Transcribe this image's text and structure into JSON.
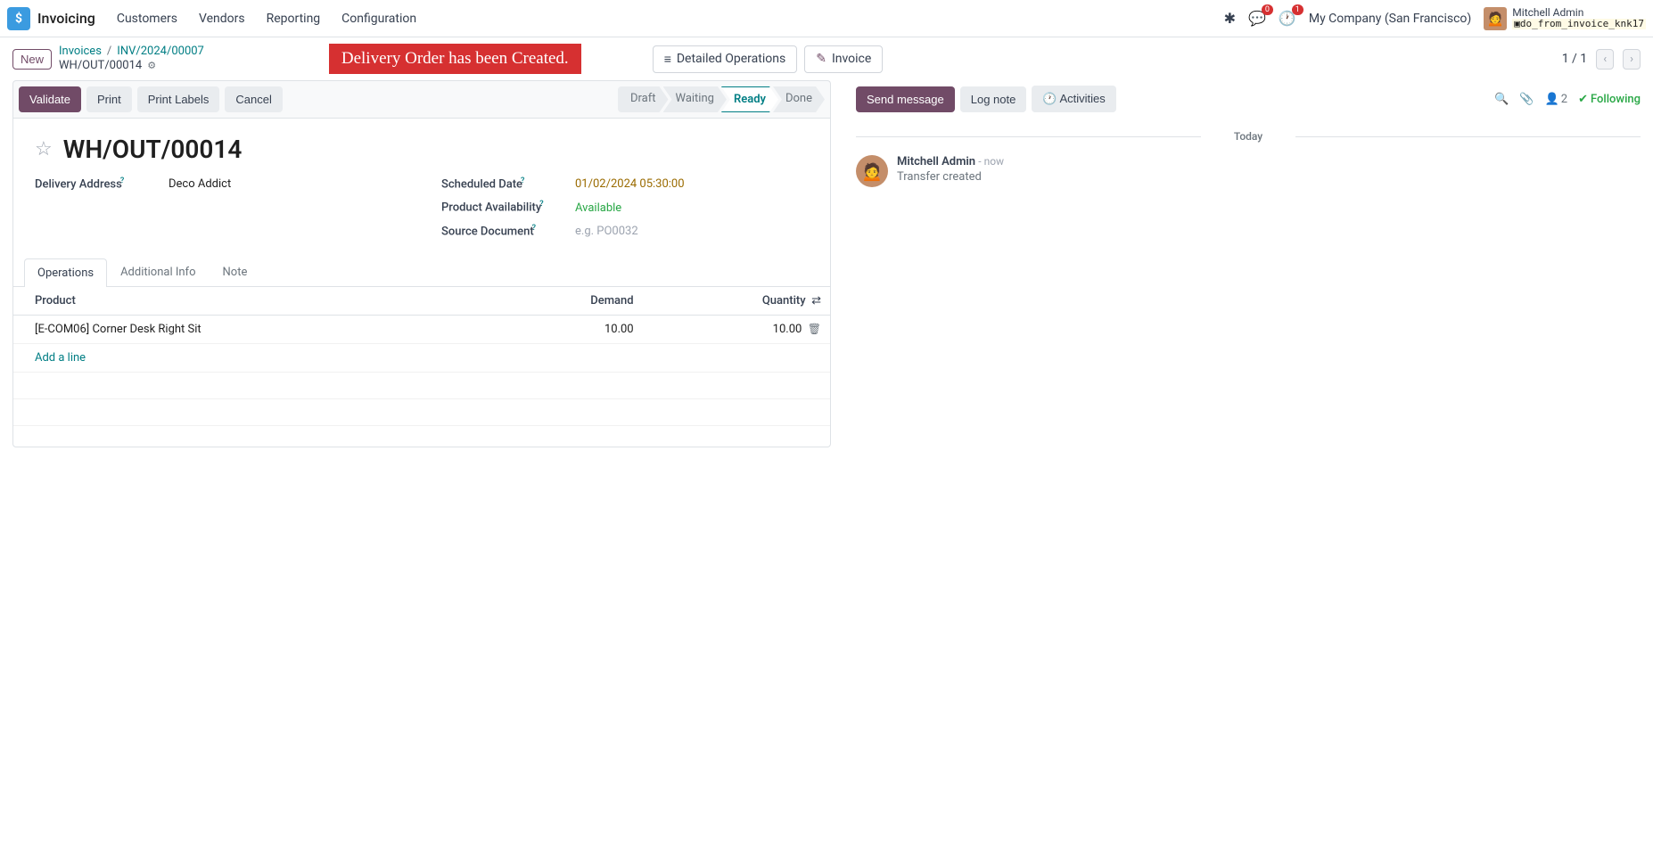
{
  "app": {
    "name": "Invoicing",
    "icon_letter": "$"
  },
  "nav": [
    "Customers",
    "Vendors",
    "Reporting",
    "Configuration"
  ],
  "header_icons": {
    "msg_badge": "0",
    "activity_badge": "1"
  },
  "company": "My Company (San Francisco)",
  "user": {
    "name": "Mitchell Admin",
    "db": "do_from_invoice_knk17"
  },
  "subbar": {
    "new": "New",
    "breadcrumb": {
      "root": "Invoices",
      "mid": "INV/2024/00007",
      "current": "WH/OUT/00014"
    },
    "alert": "Delivery Order has been Created.",
    "detailed_ops": "Detailed Operations",
    "invoice": "Invoice",
    "pager": "1 / 1"
  },
  "toolbar": {
    "validate": "Validate",
    "print": "Print",
    "print_labels": "Print Labels",
    "cancel": "Cancel",
    "statuses": [
      "Draft",
      "Waiting",
      "Ready",
      "Done"
    ],
    "active_status": "Ready"
  },
  "doc": {
    "title": "WH/OUT/00014",
    "fields": {
      "delivery_address_label": "Delivery Address",
      "delivery_address": "Deco Addict",
      "scheduled_date_label": "Scheduled Date",
      "scheduled_date": "01/02/2024 05:30:00",
      "availability_label": "Product Availability",
      "availability": "Available",
      "source_doc_label": "Source Document",
      "source_doc_placeholder": "e.g. PO0032"
    },
    "tabs": [
      "Operations",
      "Additional Info",
      "Note"
    ],
    "active_tab": "Operations",
    "table": {
      "headers": {
        "product": "Product",
        "demand": "Demand",
        "quantity": "Quantity"
      },
      "rows": [
        {
          "product": "[E-COM06] Corner Desk Right Sit",
          "demand": "10.00",
          "quantity": "10.00"
        }
      ],
      "add": "Add a line"
    }
  },
  "chatter": {
    "send": "Send message",
    "log": "Log note",
    "activities": "Activities",
    "followers_count": "2",
    "following": "Following",
    "divider": "Today",
    "msg": {
      "author": "Mitchell Admin",
      "time": "- now",
      "text": "Transfer created"
    }
  }
}
